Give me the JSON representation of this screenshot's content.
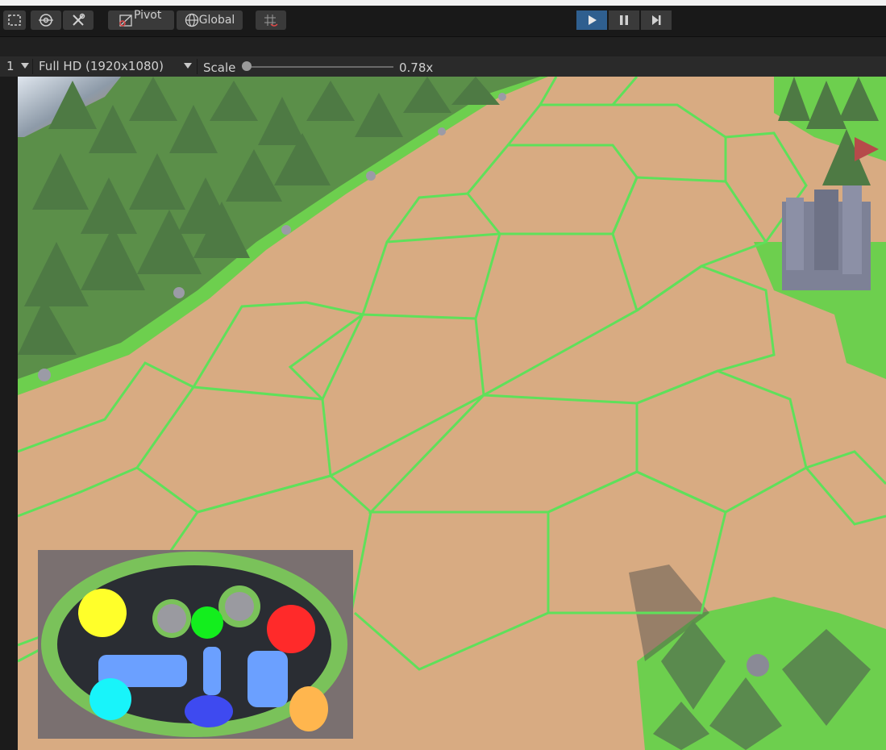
{
  "toolbar": {
    "pivot_label": "Pivot",
    "global_label": "Global",
    "play_state": "playing"
  },
  "game_view": {
    "display_label": "1",
    "resolution": "Full HD (1920x1080)",
    "scale_label": "Scale",
    "scale_value": "0.78x",
    "scale_fraction": 0.0
  },
  "colors": {
    "toolbar_bg": "#191919",
    "play_active": "#2f5f8f",
    "hex_fill": "#d8ab82",
    "hex_border": "#5fe05a",
    "grass": "#6dcf4e",
    "tree": "#5a8a4e",
    "castle": "#7d8196"
  },
  "minimap": {
    "zones": [
      {
        "name": "yellow",
        "color": "#ffff2a"
      },
      {
        "name": "green",
        "color": "#13ee1d"
      },
      {
        "name": "red",
        "color": "#ff2a2a"
      },
      {
        "name": "cyan",
        "color": "#18f4fa"
      },
      {
        "name": "blue",
        "color": "#3e4af0"
      },
      {
        "name": "orange",
        "color": "#ffb64e"
      },
      {
        "name": "lightblue",
        "color": "#6ba0ff"
      }
    ]
  }
}
